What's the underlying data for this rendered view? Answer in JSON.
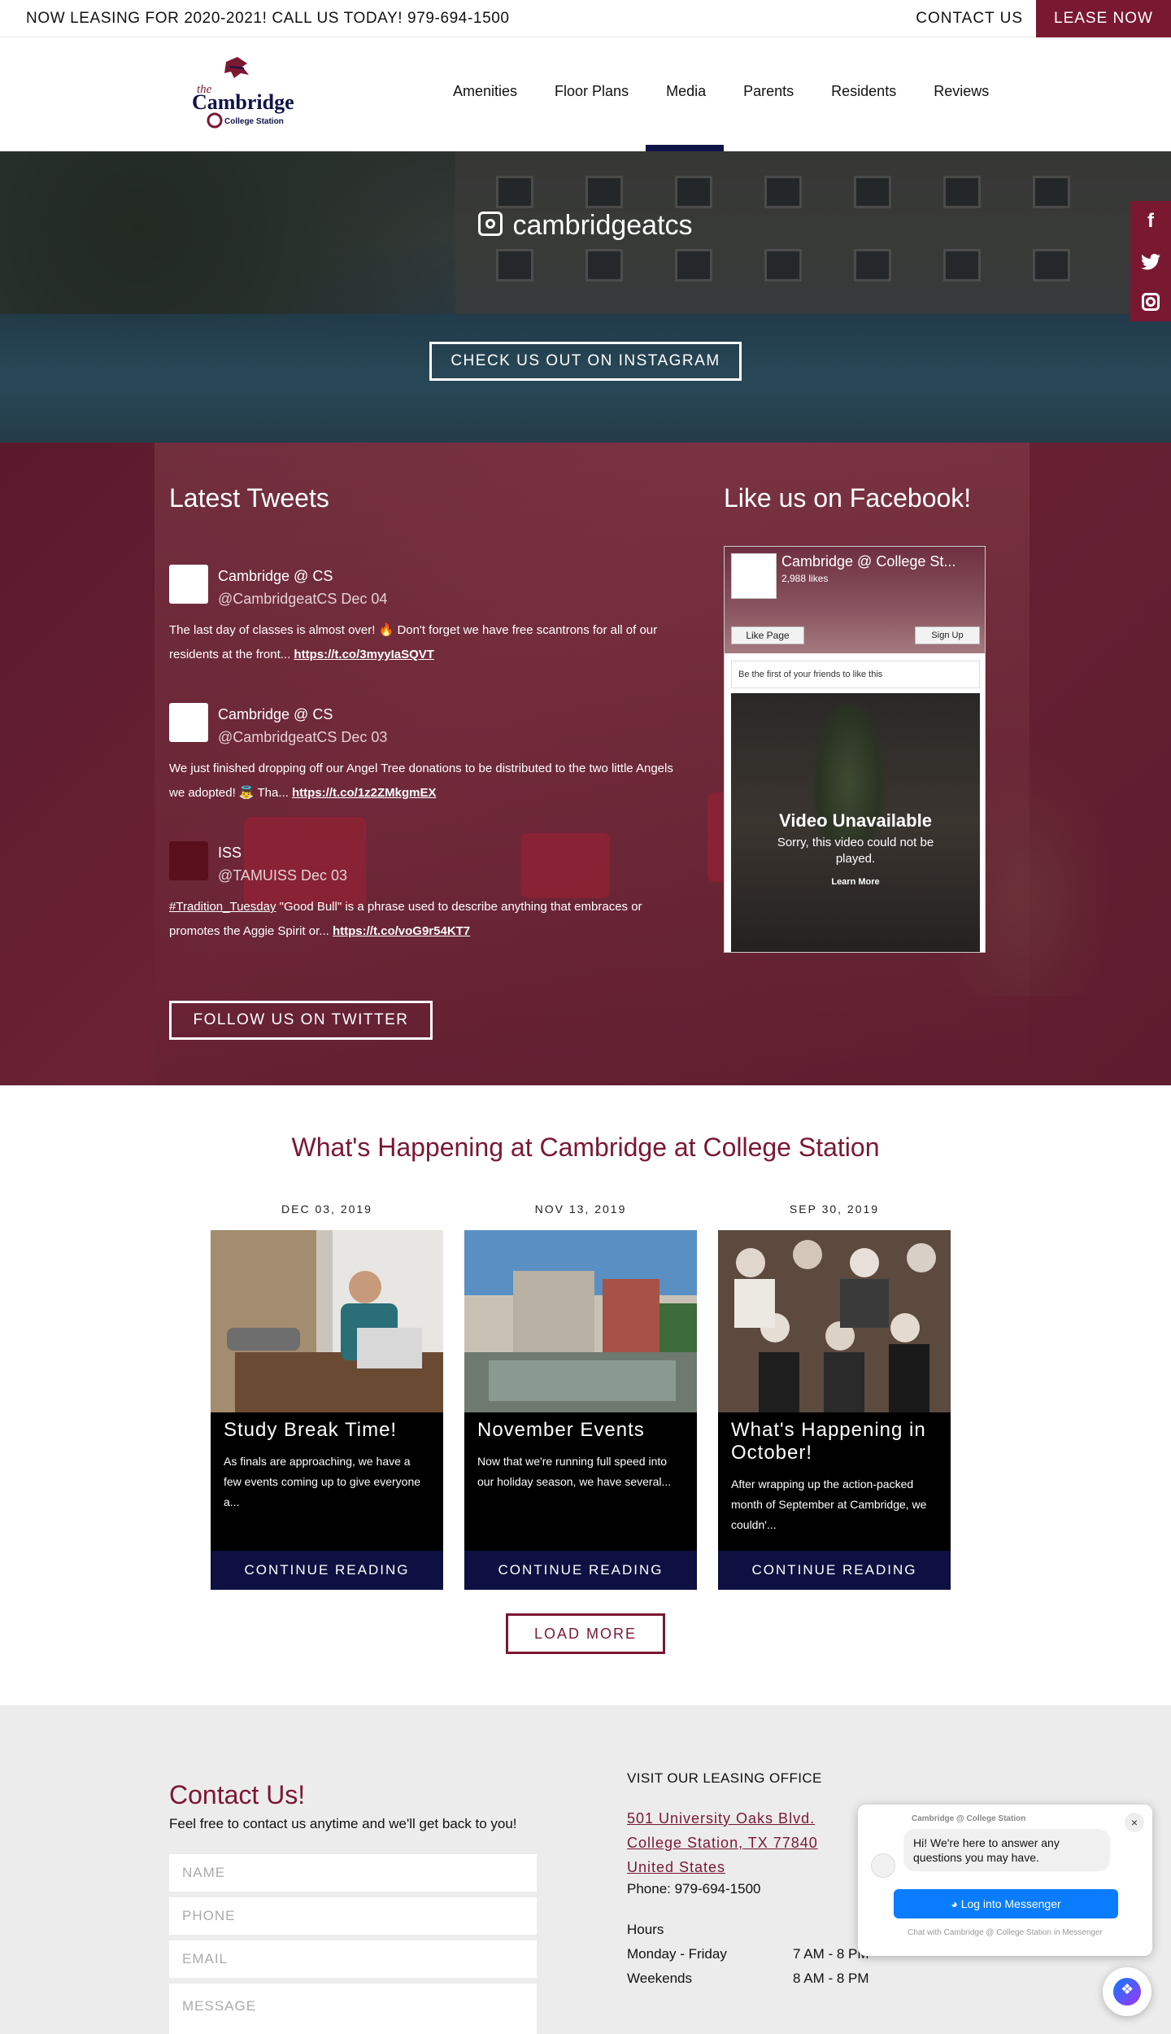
{
  "topbar": {
    "announcement": "NOW LEASING FOR 2020-2021! CALL US TODAY! 979-694-1500",
    "contact_label": "CONTACT US",
    "lease_label": "LEASE NOW"
  },
  "logo": {
    "line1": "the",
    "line2": "Cambridge",
    "line3": "College Station"
  },
  "nav": {
    "items": [
      "Amenities",
      "Floor Plans",
      "Media",
      "Parents",
      "Residents",
      "Reviews"
    ],
    "active": "Media"
  },
  "hero": {
    "instagram_handle": "cambridgeatcs",
    "instagram_button": "CHECK US OUT ON INSTAGRAM"
  },
  "social_side": {
    "icons": [
      "facebook-icon",
      "twitter-icon",
      "instagram-icon"
    ]
  },
  "tweets": {
    "title": "Latest Tweets",
    "items": [
      {
        "name": "Cambridge @ CS",
        "handle": "@CambridgeatCS Dec 04",
        "text": "The last day of classes is almost over! 🔥 Don't forget we have free scantrons for all of our residents at the front... ",
        "link": "https://t.co/3myyIaSQVT"
      },
      {
        "name": "Cambridge @ CS",
        "handle": "@CambridgeatCS Dec 03",
        "text": "We just finished dropping off our Angel Tree donations to be distributed to the two little Angels we adopted! 👼 Tha... ",
        "link": "https://t.co/1z2ZMkgmEX"
      },
      {
        "name": "ISS",
        "handle": "@TAMUISS Dec 03",
        "hashtag": "#Tradition_Tuesday",
        "text": " \"Good Bull\" is a phrase used to describe anything that embraces or promotes the Aggie Spirit or... ",
        "link": "https://t.co/voG9r54KT7"
      }
    ],
    "follow_button": "FOLLOW US ON TWITTER"
  },
  "facebook": {
    "title": "Like us on Facebook!",
    "page_name": "Cambridge @ College St...",
    "likes": "2,988 likes",
    "like_button": "Like Page",
    "signup_button": "Sign Up",
    "friends_text": "Be the first of your friends to like this",
    "video_title": "Video Unavailable",
    "video_sub": "Sorry, this video could not be played.",
    "video_link": "Learn More"
  },
  "events": {
    "title": "What's Happening at Cambridge at College Station",
    "cards": [
      {
        "date": "DEC 03, 2019",
        "title": "Study Break Time!",
        "excerpt": "As finals are approaching, we have a few events coming up to give everyone a...",
        "button": "CONTINUE READING"
      },
      {
        "date": "NOV 13, 2019",
        "title": "November Events",
        "excerpt": "Now that we're running full speed into our holiday season, we have several...",
        "button": "CONTINUE READING"
      },
      {
        "date": "SEP 30, 2019",
        "title": "What's Happening in October!",
        "excerpt": "After wrapping up the action-packed month of September at Cambridge, we couldn'...",
        "button": "CONTINUE READING"
      }
    ],
    "load_more": "LOAD MORE"
  },
  "contact": {
    "title": "Contact Us!",
    "subtitle": "Feel free to contact us anytime and we'll get back to you!",
    "fields": {
      "name": "NAME",
      "phone": "PHONE",
      "email": "EMAIL",
      "message": "MESSAGE"
    },
    "visit_title": "VISIT OUR LEASING OFFICE",
    "address": [
      "501 University Oaks Blvd.",
      "College Station, TX 77840",
      "United States"
    ],
    "phone": "Phone: 979-694-1500",
    "hours_title": "Hours",
    "hours": [
      {
        "days": "Monday - Friday",
        "time": "7 AM - 8 PM"
      },
      {
        "days": "Weekends",
        "time": "8 AM - 8 PM"
      }
    ]
  },
  "messenger": {
    "header": "Cambridge @ College Station",
    "close": "×",
    "greeting": "Hi! We're here to answer any questions you may have.",
    "button": "Log into Messenger",
    "footer": "Chat with Cambridge @ College Station in Messenger"
  },
  "colors": {
    "brand": "#7a1832",
    "navy": "#0d1040",
    "messenger": "#0a7cff"
  }
}
